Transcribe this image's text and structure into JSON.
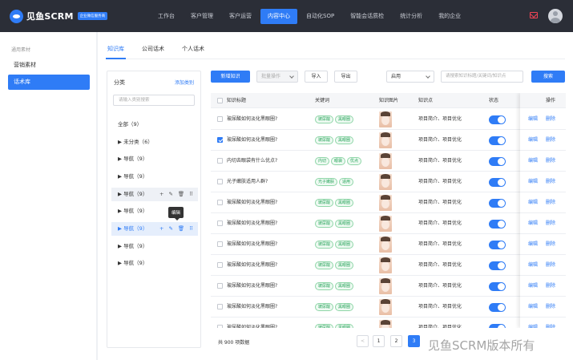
{
  "app": {
    "name": "见鱼SCRM",
    "badge": "企业微信服务商"
  },
  "nav": {
    "items": [
      "工作台",
      "客户管理",
      "客户运营",
      "内容中心",
      "自动化SOP",
      "智能会话质检",
      "统计分析",
      "我的企业"
    ],
    "active_index": 3
  },
  "sidebar": {
    "group": "通用素材",
    "items": [
      "营销素材",
      "话术库"
    ],
    "active_index": 1
  },
  "tabs": {
    "items": [
      "知识库",
      "公司话术",
      "个人话术"
    ],
    "active_index": 0
  },
  "category": {
    "title": "分类",
    "add_label": "添加类别",
    "search_placeholder": "请输入类别搜索",
    "items": [
      "全部（9）",
      "▶ 未分类（6）",
      "▶ 导航（9）",
      "▶ 导航（9）",
      "▶ 导航（9）",
      "▶ 导航（9）",
      "▶ 导航（9）",
      "▶ 导航（9）",
      "▶ 导航（9）"
    ],
    "tools": [
      "+",
      "✎",
      "🗑",
      "⠿"
    ],
    "tooltip": "编辑"
  },
  "toolbar": {
    "new_label": "新增知识",
    "batch_label": "批量操作",
    "import_label": "导入",
    "export_label": "导出",
    "status_value": "启用",
    "search_placeholder": "请搜索知识标题/关键词/知识点",
    "search_label": "搜索"
  },
  "table": {
    "headers": [
      "知识标题",
      "关键词",
      "知识图片",
      "知识点",
      "状态",
      "操作"
    ],
    "rows": [
      {
        "title": "玻尿酸如何淡化黑眼圈?",
        "tags": [
          "玻尿酸",
          "黑眼圈"
        ],
        "point": "项目简介、项目优化",
        "checked": false
      },
      {
        "title": "玻尿酸如何淡化黑眼圈?",
        "tags": [
          "玻尿酸",
          "黑眼圈"
        ],
        "point": "项目简介、项目优化",
        "checked": true
      },
      {
        "title": "内切去眼袋有什么优点?",
        "tags": [
          "内切",
          "眼袋",
          "优点"
        ],
        "point": "项目简介、项目优化",
        "checked": false
      },
      {
        "title": "光子嫩肤适用人群?",
        "tags": [
          "光子嫩肤",
          "适用"
        ],
        "point": "项目简介、项目优化",
        "checked": false
      },
      {
        "title": "玻尿酸如何淡化黑眼圈?",
        "tags": [
          "玻尿酸",
          "黑眼圈"
        ],
        "point": "项目简介、项目优化",
        "checked": false
      },
      {
        "title": "玻尿酸如何淡化黑眼圈?",
        "tags": [
          "玻尿酸",
          "黑眼圈"
        ],
        "point": "项目简介、项目优化",
        "checked": false
      },
      {
        "title": "玻尿酸如何淡化黑眼圈?",
        "tags": [
          "玻尿酸",
          "黑眼圈"
        ],
        "point": "项目简介、项目优化",
        "checked": false
      },
      {
        "title": "玻尿酸如何淡化黑眼圈?",
        "tags": [
          "玻尿酸",
          "黑眼圈"
        ],
        "point": "项目简介、项目优化",
        "checked": false
      },
      {
        "title": "玻尿酸如何淡化黑眼圈?",
        "tags": [
          "玻尿酸",
          "黑眼圈"
        ],
        "point": "项目简介、项目优化",
        "checked": false
      },
      {
        "title": "玻尿酸如何淡化黑眼圈?",
        "tags": [
          "玻尿酸",
          "黑眼圈"
        ],
        "point": "项目简介、项目优化",
        "checked": false
      },
      {
        "title": "玻尿酸如何淡化黑眼圈?",
        "tags": [
          "玻尿酸",
          "黑眼圈"
        ],
        "point": "项目简介、项目优化",
        "checked": false
      }
    ],
    "edit_label": "编辑",
    "delete_label": "删除"
  },
  "pagination": {
    "total": "共 900 项数据",
    "prev": "<",
    "pages": [
      "1",
      "2",
      "3"
    ],
    "active_page": "3"
  },
  "watermark": "见鱼SCRM版本所有"
}
